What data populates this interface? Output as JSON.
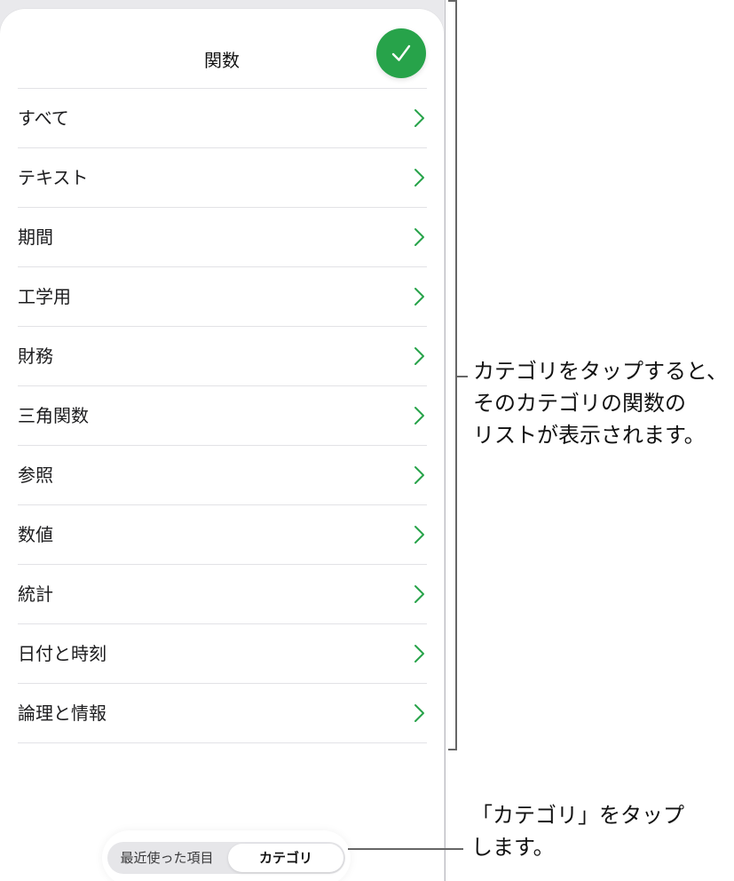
{
  "sheet": {
    "title": "関数",
    "done_icon": "checkmark-icon",
    "accent_color": "#27a34a"
  },
  "categories": [
    {
      "label": "すべて"
    },
    {
      "label": "テキスト"
    },
    {
      "label": "期間"
    },
    {
      "label": "工学用"
    },
    {
      "label": "財務"
    },
    {
      "label": "三角関数"
    },
    {
      "label": "参照"
    },
    {
      "label": "数値"
    },
    {
      "label": "統計"
    },
    {
      "label": "日付と時刻"
    },
    {
      "label": "論理と情報"
    }
  ],
  "segmented_control": {
    "recent_label": "最近使った項目",
    "category_label": "カテゴリ",
    "selected": "カテゴリ"
  },
  "callouts": {
    "categories_text": "カテゴリをタップすると、\nそのカテゴリの関数の\nリストが表示されます。",
    "tab_text": "「カテゴリ」をタップ\nします。"
  }
}
